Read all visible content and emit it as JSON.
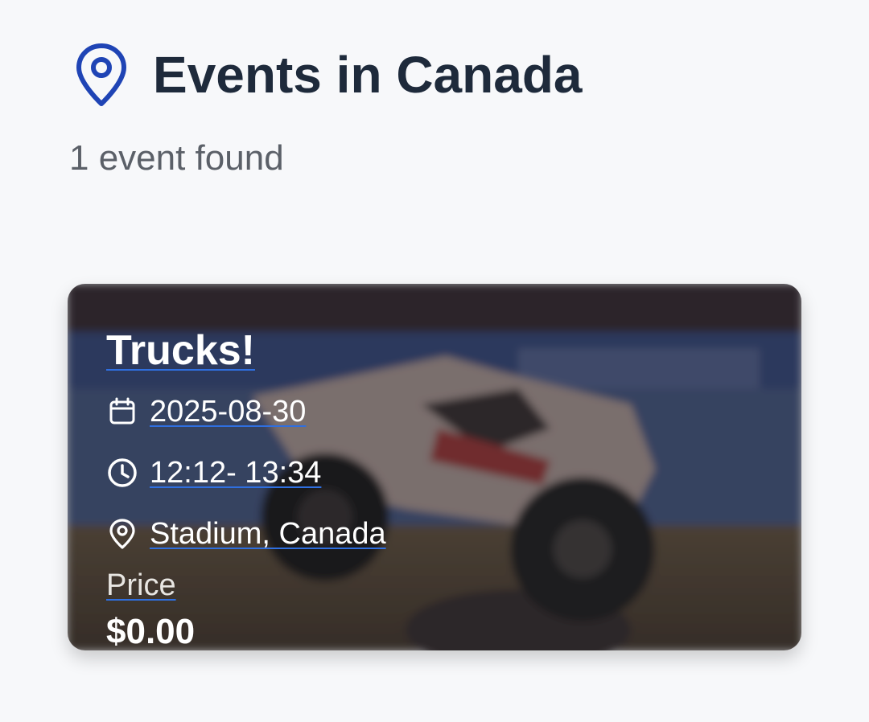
{
  "header": {
    "icon": "map-pin-icon",
    "title": "Events in Canada",
    "accent_color": "#1f44b5"
  },
  "results": {
    "count_text": "1 event found"
  },
  "events": [
    {
      "title": "Trucks!",
      "date": "2025-08-30",
      "time": "12:12- 13:34",
      "location": "Stadium, Canada",
      "price_label": "Price",
      "price": "$0.00",
      "image": "monster-truck-photo",
      "icons": {
        "date": "calendar-icon",
        "time": "clock-icon",
        "location": "map-pin-icon"
      }
    }
  ],
  "colors": {
    "background": "#f7f8fa",
    "title_text": "#1e2a3b",
    "muted_text": "#5b6068",
    "link_underline": "#2f6fe0"
  }
}
